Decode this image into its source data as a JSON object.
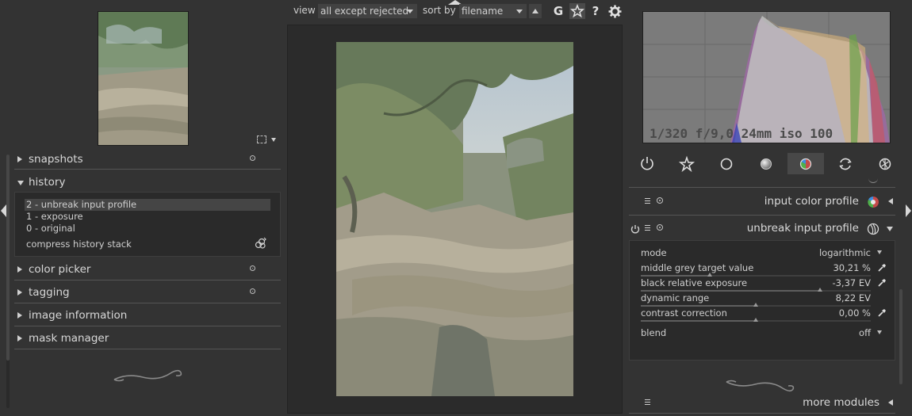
{
  "toolbar": {
    "view_label": "view",
    "view_value": "all except rejected",
    "sort_label": "sort by",
    "sort_value": "filename",
    "btn_g": "G",
    "btn_help": "?"
  },
  "left_panel": {
    "sections": [
      {
        "label": "snapshots"
      },
      {
        "label": "history"
      },
      {
        "label": "color picker"
      },
      {
        "label": "tagging"
      },
      {
        "label": "image information"
      },
      {
        "label": "mask manager"
      }
    ],
    "history_items": [
      "2 - unbreak input profile",
      "1 - exposure",
      "0 - original"
    ],
    "compress_label": "compress history stack"
  },
  "histogram": {
    "exif": "1/320 f/9,0 24mm iso 100"
  },
  "modules": {
    "input_color_profile": "input color profile",
    "unbreak_input_profile": "unbreak input profile",
    "more_modules": "more modules"
  },
  "unbreak_params": [
    {
      "label": "mode",
      "value": "logarithmic",
      "type": "combo"
    },
    {
      "label": "middle grey target value",
      "value": "30,21 %",
      "type": "slider",
      "level": 0.3
    },
    {
      "label": "black relative exposure",
      "value": "-3,37 EV",
      "type": "slider",
      "level": 0.78
    },
    {
      "label": "dynamic range",
      "value": "8,22 EV",
      "type": "slider",
      "level": 0.5
    },
    {
      "label": "contrast correction",
      "value": "0,00 %",
      "type": "slider",
      "level": 0.5
    }
  ],
  "blend": {
    "label": "blend",
    "value": "off"
  },
  "icons": {
    "groups": [
      "power-icon",
      "star-icon",
      "circle-icon",
      "sphere-icon",
      "color-icon",
      "rotate-icon",
      "aperture-icon"
    ],
    "active_group": 4
  }
}
